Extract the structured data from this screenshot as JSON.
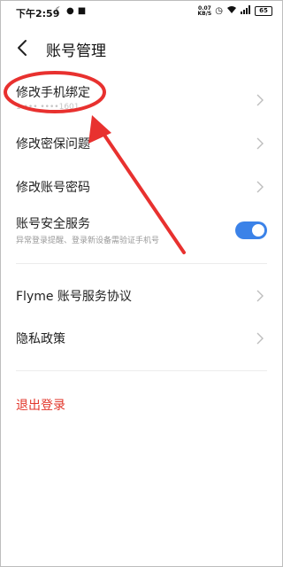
{
  "status_bar": {
    "time": "下午2:59",
    "net_speed_value": "0.07",
    "net_speed_unit": "KB/S",
    "battery": "65"
  },
  "header": {
    "title": "账号管理"
  },
  "items": [
    {
      "label": "修改手机绑定",
      "sub": "1 ••• ••••1601"
    },
    {
      "label": "修改密保问题"
    },
    {
      "label": "修改账号密码"
    },
    {
      "label": "账号安全服务",
      "sub": "异常登录提醒、登录新设备需验证手机号",
      "toggle_on": true
    },
    {
      "label": "Flyme 账号服务协议"
    },
    {
      "label": "隐私政策"
    }
  ],
  "logout_label": "退出登录",
  "colors": {
    "accent": "#3b82e8",
    "danger": "#e2362b",
    "annotation": "#e8312f"
  }
}
